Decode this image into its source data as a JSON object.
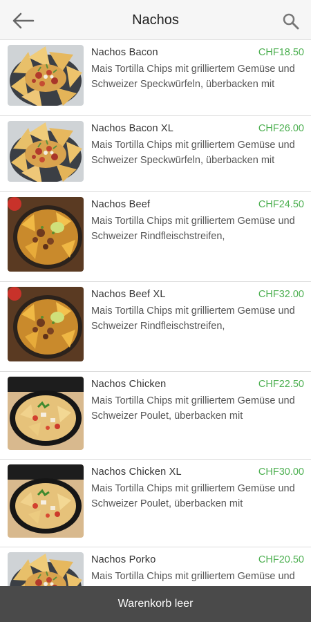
{
  "header": {
    "title": "Nachos",
    "back_icon": "arrow-left-icon",
    "search_icon": "search-icon"
  },
  "items": [
    {
      "name": "Nachos Bacon",
      "price": "CHF18.50",
      "description": "Mais Tortilla Chips mit grilliertem Gemüse und Schweizer Speckwürfeln, überbacken mit",
      "image": "bacon"
    },
    {
      "name": "Nachos Bacon XL",
      "price": "CHF26.00",
      "description": "Mais Tortilla Chips mit grilliertem Gemüse und Schweizer Speckwürfeln, überbacken mit",
      "image": "bacon"
    },
    {
      "name": "Nachos Beef",
      "price": "CHF24.50",
      "description": "Mais Tortilla Chips mit grilliertem Gemüse und Schweizer Rindfleischstreifen,",
      "image": "beef"
    },
    {
      "name": "Nachos Beef XL",
      "price": "CHF32.00",
      "description": "Mais Tortilla Chips mit grilliertem Gemüse und Schweizer Rindfleischstreifen,",
      "image": "beef"
    },
    {
      "name": "Nachos Chicken",
      "price": "CHF22.50",
      "description": "Mais Tortilla Chips mit grilliertem Gemüse und Schweizer Poulet, überbacken mit",
      "image": "chicken"
    },
    {
      "name": "Nachos Chicken XL",
      "price": "CHF30.00",
      "description": "Mais Tortilla Chips mit grilliertem Gemüse und Schweizer Poulet, überbacken mit",
      "image": "chicken"
    },
    {
      "name": "Nachos Porko",
      "price": "CHF20.50",
      "description": "Mais Tortilla Chips mit grilliertem Gemüse und Schweizer",
      "image": "bacon"
    }
  ],
  "cart": {
    "label": "Warenkorb leer"
  },
  "colors": {
    "price": "#4caf50",
    "cartbar": "#4a4a4a",
    "appbar": "#f6f6f6"
  }
}
